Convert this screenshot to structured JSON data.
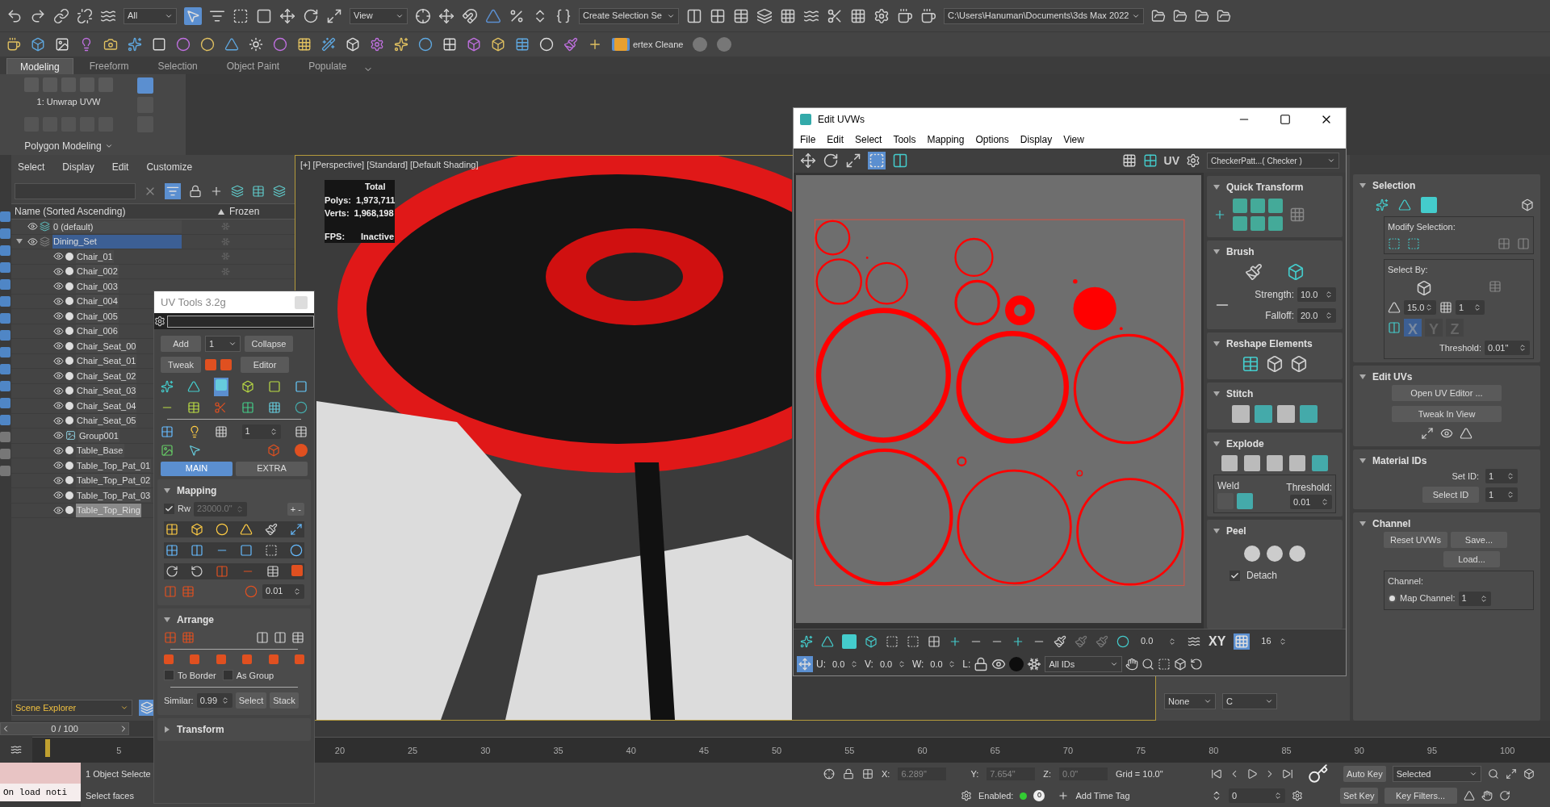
{
  "toolbar": {
    "filter": "All",
    "ref_coord": "View",
    "selection_set": "Create Selection Se",
    "project_path": "C:\\Users\\Hanuman\\Documents\\3ds Max 2022",
    "plugin_label": "ertex Cleane"
  },
  "ribbon": {
    "tabs": [
      {
        "label": "Modeling",
        "selected": true
      },
      {
        "label": "Freeform",
        "selected": false
      },
      {
        "label": "Selection",
        "selected": false
      },
      {
        "label": "Object Paint",
        "selected": false
      },
      {
        "label": "Populate",
        "selected": false
      }
    ],
    "modifier": "1: Unwrap UVW",
    "panel": "Polygon Modeling"
  },
  "scene_explorer": {
    "menu": [
      "Select",
      "Display",
      "Edit",
      "Customize"
    ],
    "columns": [
      "Name (Sorted Ascending)",
      "Frozen"
    ],
    "tree": [
      {
        "name": "0 (default)",
        "kind": "layer",
        "selected": false
      },
      {
        "name": "Dining_Set",
        "kind": "layer",
        "selected": true,
        "expanded": true,
        "children": [
          {
            "name": "Chair_01",
            "kind": "object",
            "selected": false
          },
          {
            "name": "Chair_002",
            "kind": "object",
            "selected": false
          },
          {
            "name": "Chair_003",
            "kind": "object",
            "selected": false
          },
          {
            "name": "Chair_004",
            "kind": "object",
            "selected": false
          },
          {
            "name": "Chair_005",
            "kind": "object",
            "selected": false
          },
          {
            "name": "Chair_006",
            "kind": "object",
            "selected": false
          },
          {
            "name": "Chair_Seat_00",
            "kind": "object",
            "selected": false
          },
          {
            "name": "Chair_Seat_01",
            "kind": "object",
            "selected": false
          },
          {
            "name": "Chair_Seat_02",
            "kind": "object",
            "selected": false
          },
          {
            "name": "Chair_Seat_03",
            "kind": "object",
            "selected": false
          },
          {
            "name": "Chair_Seat_04",
            "kind": "object",
            "selected": false
          },
          {
            "name": "Chair_Seat_05",
            "kind": "object",
            "selected": false
          },
          {
            "name": "Group001",
            "kind": "group",
            "selected": false
          },
          {
            "name": "Table_Base",
            "kind": "object",
            "selected": false
          },
          {
            "name": "Table_Top_Pat_01",
            "kind": "object",
            "selected": false
          },
          {
            "name": "Table_Top_Pat_02",
            "kind": "object",
            "selected": false
          },
          {
            "name": "Table_Top_Pat_03",
            "kind": "object",
            "selected": false
          },
          {
            "name": "Table_Top_Ring",
            "kind": "object",
            "selected": true
          }
        ]
      }
    ],
    "footer": "Scene Explorer"
  },
  "viewport": {
    "label": "[+] [Perspective] [Standard] [Default Shading]",
    "stats_header": "Total",
    "stats": [
      {
        "label": "Polys:",
        "value": "1,973,711"
      },
      {
        "label": "Verts:",
        "value": "1,968,198"
      }
    ],
    "fps_label": "FPS:",
    "fps_value": "Inactive"
  },
  "uv_tools": {
    "title": "UV Tools 3.2g",
    "add": "Add",
    "count": "1",
    "collapse": "Collapse",
    "tweak": "Tweak",
    "editor": "Editor",
    "spinner": "1",
    "tabs": [
      {
        "label": "MAIN",
        "selected": true
      },
      {
        "label": "EXTRA",
        "selected": false
      }
    ],
    "mapping": {
      "title": "Mapping",
      "expanded": true,
      "rw_checked": true,
      "rw_label": "Rw",
      "rw_value": "23000.0\"",
      "plus_minus": "+ -",
      "value": "0.01"
    },
    "arrange": {
      "title": "Arrange",
      "expanded": true,
      "options": [
        {
          "label": "To Border",
          "checked": false
        },
        {
          "label": "As Group",
          "checked": false
        }
      ],
      "similar_label": "Similar:",
      "similar_value": "0.99",
      "select": "Select",
      "stack": "Stack"
    },
    "transform": {
      "title": "Transform",
      "expanded": false
    }
  },
  "edit_uvws": {
    "title": "Edit UVWs",
    "menu": [
      "File",
      "Edit",
      "Select",
      "Tools",
      "Mapping",
      "Options",
      "Display",
      "View"
    ],
    "uv_label": "UV",
    "texture": "CheckerPatt...( Checker )",
    "quick_transform": {
      "title": "Quick Transform"
    },
    "brush": {
      "title": "Brush",
      "strength_label": "Strength:",
      "strength": "10.0",
      "falloff_label": "Falloff:",
      "falloff": "20.0"
    },
    "reshape": {
      "title": "Reshape Elements"
    },
    "stitch": {
      "title": "Stitch"
    },
    "explode": {
      "title": "Explode",
      "weld_label": "Weld",
      "threshold_label": "Threshold:",
      "threshold": "0.01"
    },
    "peel": {
      "title": "Peel",
      "detach_label": "Detach",
      "detach_checked": true
    },
    "bottom": {
      "angle": "0.0",
      "axis": "XY",
      "grid": "16",
      "u_label": "U:",
      "u": "0.0",
      "v_label": "V:",
      "v": "0.0",
      "w_label": "W:",
      "w": "0.0",
      "l_label": "L:",
      "ids": "All IDs"
    }
  },
  "middle_panel": {
    "dropdowns": [
      "None",
      "C"
    ]
  },
  "command_panel": {
    "selection": {
      "title": "Selection",
      "modify_label": "Modify Selection:",
      "select_by_label": "Select By:",
      "angle": "15.0",
      "count": "1",
      "axes": [
        {
          "label": "X",
          "selected": true
        },
        {
          "label": "Y",
          "selected": false
        },
        {
          "label": "Z",
          "selected": false
        }
      ],
      "threshold_label": "Threshold:",
      "threshold": "0.01\""
    },
    "edit_uvs": {
      "title": "Edit UVs",
      "buttons": [
        "Open UV Editor ...",
        "Tweak In View"
      ]
    },
    "material_ids": {
      "title": "Material IDs",
      "set_id_label": "Set ID:",
      "set_id": "1",
      "select_id": "Select ID",
      "select_id_value": "1"
    },
    "channel": {
      "title": "Channel",
      "reset": "Reset UVWs",
      "save": "Save...",
      "load": "Load...",
      "group_label": "Channel:",
      "options": [
        {
          "label": "Map Channel:",
          "selected": true,
          "value": "1"
        }
      ]
    }
  },
  "timeline": {
    "frame": "0 / 100",
    "level": 0,
    "ticks": [
      "5",
      "20",
      "25",
      "30",
      "35",
      "40",
      "45",
      "50",
      "55",
      "60",
      "65",
      "70",
      "75",
      "80",
      "85",
      "90",
      "95",
      "100"
    ]
  },
  "status": {
    "script_output": "On load noti",
    "selection": "1 Object Selecte",
    "prompt": "Select faces",
    "x_label": "X:",
    "x": "6.289\"",
    "y_label": "Y:",
    "y": "7.654\"",
    "z_label": "Z:",
    "z": "0.0\"",
    "grid": "Grid = 10.0\"",
    "enabled_label": "Enabled:",
    "enabled_value": "0",
    "add_time_tag": "Add Time Tag",
    "frame": "0",
    "auto_key": "Auto Key",
    "key_mode": "Selected",
    "set_key": "Set Key",
    "key_filters": "Key Filters..."
  }
}
